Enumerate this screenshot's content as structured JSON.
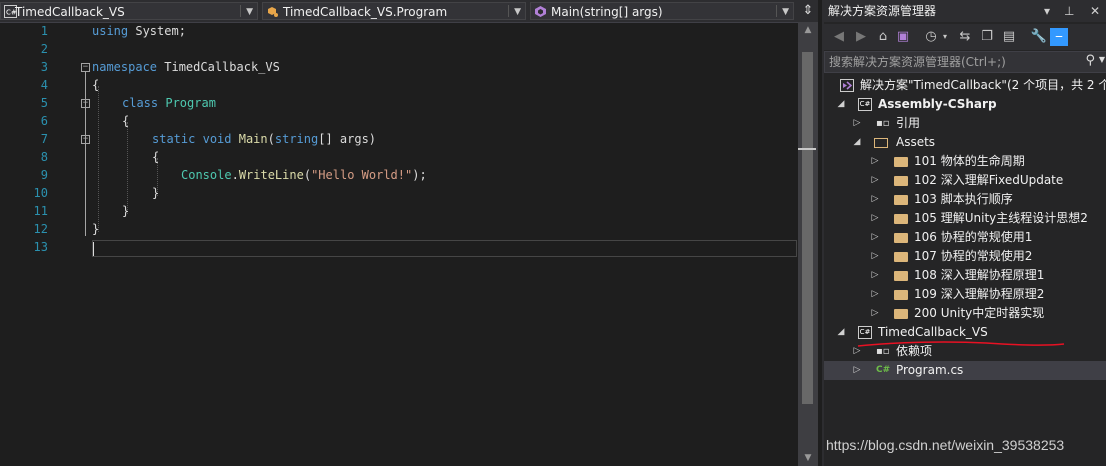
{
  "editor": {
    "nav": {
      "project": "TimedCallback_VS",
      "class": "TimedCallback_VS.Program",
      "member": "Main(string[] args)"
    },
    "line_numbers": [
      "1",
      "2",
      "3",
      "4",
      "5",
      "6",
      "7",
      "8",
      "9",
      "10",
      "11",
      "12",
      "13"
    ],
    "code": {
      "l1_kw": "using",
      "l1_rest": " System;",
      "l3_kw": "namespace",
      "l3_rest": " TimedCallback_VS",
      "l4": "{",
      "l5_kw": "class",
      "l5_ty": "Program",
      "l6": "{",
      "l7_kw1": "static",
      "l7_kw2": "void",
      "l7_fn": "Main",
      "l7_open": "(",
      "l7_kw3": "string",
      "l7_args": "[] args)",
      "l8": "{",
      "l9_ty": "Console",
      "l9_dot": ".",
      "l9_fn": "WriteLine",
      "l9_open": "(",
      "l9_str": "\"Hello World!\"",
      "l9_close": ");",
      "l10": "}",
      "l11": "}",
      "l12": "}"
    }
  },
  "explorer": {
    "title": "解决方案资源管理器",
    "pin": "▾ ⊥",
    "close": "✕",
    "search_placeholder": "搜索解决方案资源管理器(Ctrl+;)",
    "solution": "解决方案\"TimedCallback\"(2 个项目，共 2 个",
    "assembly": "Assembly-CSharp",
    "references": "引用",
    "assets": "Assets",
    "folders": [
      "101 物体的生命周期",
      "102 深入理解FixedUpdate",
      "103 脚本执行顺序",
      "105 理解Unity主线程设计思想2",
      "106 协程的常规使用1",
      "107 协程的常规使用2",
      "108 深入理解协程原理1",
      "109 深入理解协程原理2",
      "200 Unity中定时器实现"
    ],
    "project": "TimedCallback_VS",
    "dependencies": "依赖项",
    "program_file": "Program.cs",
    "cs_badge": "C#"
  },
  "watermark": "https://blog.csdn.net/weixin_39538253"
}
